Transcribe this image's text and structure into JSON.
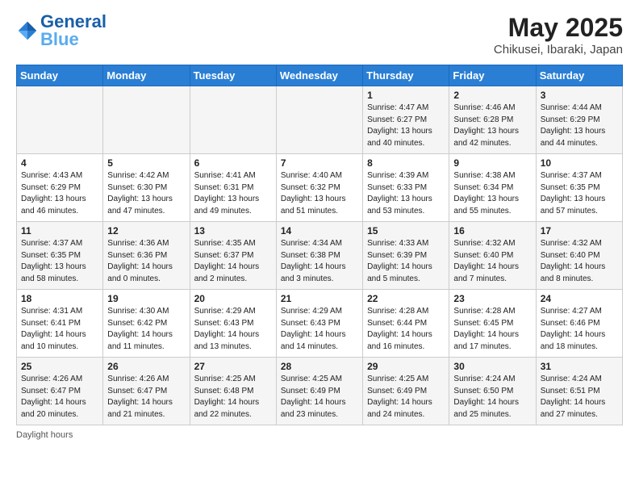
{
  "header": {
    "logo_text_general": "General",
    "logo_text_blue": "Blue",
    "main_title": "May 2025",
    "subtitle": "Chikusei, Ibaraki, Japan"
  },
  "weekdays": [
    "Sunday",
    "Monday",
    "Tuesday",
    "Wednesday",
    "Thursday",
    "Friday",
    "Saturday"
  ],
  "weeks": [
    [
      {
        "day": "",
        "sunrise": "",
        "sunset": "",
        "daylight": ""
      },
      {
        "day": "",
        "sunrise": "",
        "sunset": "",
        "daylight": ""
      },
      {
        "day": "",
        "sunrise": "",
        "sunset": "",
        "daylight": ""
      },
      {
        "day": "",
        "sunrise": "",
        "sunset": "",
        "daylight": ""
      },
      {
        "day": "1",
        "sunrise": "Sunrise: 4:47 AM",
        "sunset": "Sunset: 6:27 PM",
        "daylight": "Daylight: 13 hours and 40 minutes."
      },
      {
        "day": "2",
        "sunrise": "Sunrise: 4:46 AM",
        "sunset": "Sunset: 6:28 PM",
        "daylight": "Daylight: 13 hours and 42 minutes."
      },
      {
        "day": "3",
        "sunrise": "Sunrise: 4:44 AM",
        "sunset": "Sunset: 6:29 PM",
        "daylight": "Daylight: 13 hours and 44 minutes."
      }
    ],
    [
      {
        "day": "4",
        "sunrise": "Sunrise: 4:43 AM",
        "sunset": "Sunset: 6:29 PM",
        "daylight": "Daylight: 13 hours and 46 minutes."
      },
      {
        "day": "5",
        "sunrise": "Sunrise: 4:42 AM",
        "sunset": "Sunset: 6:30 PM",
        "daylight": "Daylight: 13 hours and 47 minutes."
      },
      {
        "day": "6",
        "sunrise": "Sunrise: 4:41 AM",
        "sunset": "Sunset: 6:31 PM",
        "daylight": "Daylight: 13 hours and 49 minutes."
      },
      {
        "day": "7",
        "sunrise": "Sunrise: 4:40 AM",
        "sunset": "Sunset: 6:32 PM",
        "daylight": "Daylight: 13 hours and 51 minutes."
      },
      {
        "day": "8",
        "sunrise": "Sunrise: 4:39 AM",
        "sunset": "Sunset: 6:33 PM",
        "daylight": "Daylight: 13 hours and 53 minutes."
      },
      {
        "day": "9",
        "sunrise": "Sunrise: 4:38 AM",
        "sunset": "Sunset: 6:34 PM",
        "daylight": "Daylight: 13 hours and 55 minutes."
      },
      {
        "day": "10",
        "sunrise": "Sunrise: 4:37 AM",
        "sunset": "Sunset: 6:35 PM",
        "daylight": "Daylight: 13 hours and 57 minutes."
      }
    ],
    [
      {
        "day": "11",
        "sunrise": "Sunrise: 4:37 AM",
        "sunset": "Sunset: 6:35 PM",
        "daylight": "Daylight: 13 hours and 58 minutes."
      },
      {
        "day": "12",
        "sunrise": "Sunrise: 4:36 AM",
        "sunset": "Sunset: 6:36 PM",
        "daylight": "Daylight: 14 hours and 0 minutes."
      },
      {
        "day": "13",
        "sunrise": "Sunrise: 4:35 AM",
        "sunset": "Sunset: 6:37 PM",
        "daylight": "Daylight: 14 hours and 2 minutes."
      },
      {
        "day": "14",
        "sunrise": "Sunrise: 4:34 AM",
        "sunset": "Sunset: 6:38 PM",
        "daylight": "Daylight: 14 hours and 3 minutes."
      },
      {
        "day": "15",
        "sunrise": "Sunrise: 4:33 AM",
        "sunset": "Sunset: 6:39 PM",
        "daylight": "Daylight: 14 hours and 5 minutes."
      },
      {
        "day": "16",
        "sunrise": "Sunrise: 4:32 AM",
        "sunset": "Sunset: 6:40 PM",
        "daylight": "Daylight: 14 hours and 7 minutes."
      },
      {
        "day": "17",
        "sunrise": "Sunrise: 4:32 AM",
        "sunset": "Sunset: 6:40 PM",
        "daylight": "Daylight: 14 hours and 8 minutes."
      }
    ],
    [
      {
        "day": "18",
        "sunrise": "Sunrise: 4:31 AM",
        "sunset": "Sunset: 6:41 PM",
        "daylight": "Daylight: 14 hours and 10 minutes."
      },
      {
        "day": "19",
        "sunrise": "Sunrise: 4:30 AM",
        "sunset": "Sunset: 6:42 PM",
        "daylight": "Daylight: 14 hours and 11 minutes."
      },
      {
        "day": "20",
        "sunrise": "Sunrise: 4:29 AM",
        "sunset": "Sunset: 6:43 PM",
        "daylight": "Daylight: 14 hours and 13 minutes."
      },
      {
        "day": "21",
        "sunrise": "Sunrise: 4:29 AM",
        "sunset": "Sunset: 6:43 PM",
        "daylight": "Daylight: 14 hours and 14 minutes."
      },
      {
        "day": "22",
        "sunrise": "Sunrise: 4:28 AM",
        "sunset": "Sunset: 6:44 PM",
        "daylight": "Daylight: 14 hours and 16 minutes."
      },
      {
        "day": "23",
        "sunrise": "Sunrise: 4:28 AM",
        "sunset": "Sunset: 6:45 PM",
        "daylight": "Daylight: 14 hours and 17 minutes."
      },
      {
        "day": "24",
        "sunrise": "Sunrise: 4:27 AM",
        "sunset": "Sunset: 6:46 PM",
        "daylight": "Daylight: 14 hours and 18 minutes."
      }
    ],
    [
      {
        "day": "25",
        "sunrise": "Sunrise: 4:26 AM",
        "sunset": "Sunset: 6:47 PM",
        "daylight": "Daylight: 14 hours and 20 minutes."
      },
      {
        "day": "26",
        "sunrise": "Sunrise: 4:26 AM",
        "sunset": "Sunset: 6:47 PM",
        "daylight": "Daylight: 14 hours and 21 minutes."
      },
      {
        "day": "27",
        "sunrise": "Sunrise: 4:25 AM",
        "sunset": "Sunset: 6:48 PM",
        "daylight": "Daylight: 14 hours and 22 minutes."
      },
      {
        "day": "28",
        "sunrise": "Sunrise: 4:25 AM",
        "sunset": "Sunset: 6:49 PM",
        "daylight": "Daylight: 14 hours and 23 minutes."
      },
      {
        "day": "29",
        "sunrise": "Sunrise: 4:25 AM",
        "sunset": "Sunset: 6:49 PM",
        "daylight": "Daylight: 14 hours and 24 minutes."
      },
      {
        "day": "30",
        "sunrise": "Sunrise: 4:24 AM",
        "sunset": "Sunset: 6:50 PM",
        "daylight": "Daylight: 14 hours and 25 minutes."
      },
      {
        "day": "31",
        "sunrise": "Sunrise: 4:24 AM",
        "sunset": "Sunset: 6:51 PM",
        "daylight": "Daylight: 14 hours and 27 minutes."
      }
    ]
  ],
  "footer": {
    "daylight_label": "Daylight hours"
  }
}
